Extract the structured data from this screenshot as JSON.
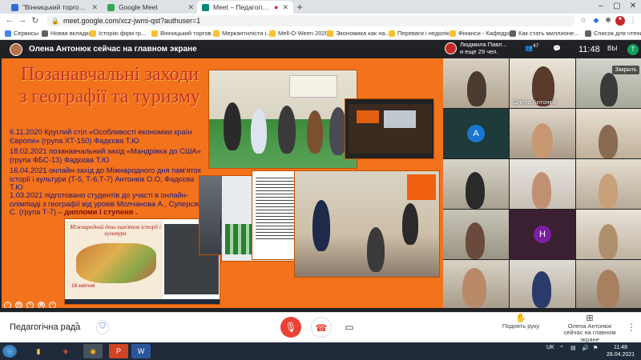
{
  "browser": {
    "tabs": [
      {
        "label": "\"Вінницький торговельно-екон...",
        "active": false
      },
      {
        "label": "Google Meet",
        "active": false
      },
      {
        "label": "Meet – Педагогічна рада",
        "active": true
      }
    ],
    "url": "meet.google.com/xcz-jwmi-qst?authuser=1",
    "bookmarks": [
      "Сервисы",
      "Новая вкладка",
      "Історію фірм гр...",
      "Вінницький торгов...",
      "Меркантилісти і...",
      "Mell-O-Ween 2020",
      "Экономика как на...",
      "Переваги і недолік...",
      "Фінанси - Кафедра...",
      "Как стать миллионе..."
    ],
    "reading_list": "Список для чтения"
  },
  "meet": {
    "presenter_banner": "Олена Антонюк сейчас на главном экране",
    "active_speaker": {
      "name": "Людмила Павл...",
      "others": "и еще 29 чел."
    },
    "participant_count": "47",
    "time": "11:48",
    "self_initial": "T",
    "close_label": "Закрыть",
    "meeting_name": "Педагогічна рада",
    "raise_hand": "Поднять руку",
    "presenting_label": "Олена Антонюк сейчас на главном экране",
    "pinned_tile_name": "Олена Антонюк",
    "avatar_letters": [
      "A",
      "H"
    ]
  },
  "slide": {
    "title": "Позанавчальні заходи з географії та туризму",
    "lines": [
      {
        "text": "6.11.2020 Круглий стіл «Особливості економіки країн Європи» (група ХТ-150) Фадєєва Т.Ю",
        "highlight": ""
      },
      {
        "text": "18.02.2021 позанавчальний захід «Мандрівка до США» (група ФБС-13) Фадєєва Т.Ю",
        "highlight": ""
      },
      {
        "text": "16.04.2021  онлайн-захід до Міжнародного дня пам'яток історії і культури (Т-5, Т-6,Т-7) Антонюк О.О, Фадєєва Т.Ю",
        "highlight": ""
      },
      {
        "text": "1.03.2021 підготовано студентів до участі в онлайн-олімпіаді з географії від уроків Молчанова А., Суперсян С. (група Т-7) – ",
        "highlight": "дипломи І ступеня ."
      }
    ],
    "map_title": "Міжнародний день пам'яток історії і культури",
    "map_date": "18 квітня"
  },
  "taskbar": {
    "lang": "UK",
    "time": "11:48",
    "date": "28.04.2021"
  },
  "colors": {
    "slide_bg": "#f3721c",
    "title_red": "#c0342a",
    "text_blue": "#1a1a80",
    "end_call_red": "#ea4335"
  }
}
